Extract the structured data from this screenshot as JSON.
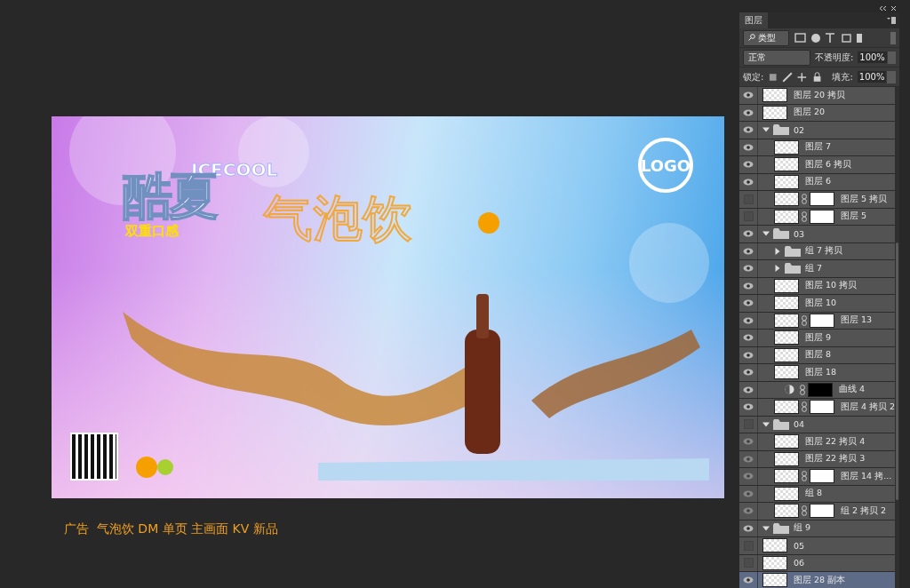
{
  "panel": {
    "tab": "图层",
    "filter": "类型",
    "blend_mode": "正常",
    "opacity_label": "不透明度:",
    "opacity": "100%",
    "lock_label": "锁定:",
    "fill_label": "填充:",
    "fill": "100%"
  },
  "layers": [
    {
      "name": "图层 20 拷贝",
      "kind": "layer",
      "mask": false,
      "visible": true,
      "selected": false
    },
    {
      "name": "图层 20",
      "kind": "layer",
      "mask": false,
      "visible": true,
      "selected": false
    },
    {
      "name": "02",
      "kind": "group",
      "expanded": true,
      "visible": true,
      "selected": false,
      "children": [
        {
          "name": "图层 7",
          "kind": "layer",
          "mask": false,
          "visible": true,
          "selected": false
        },
        {
          "name": "图层 6 拷贝",
          "kind": "layer",
          "mask": false,
          "visible": true,
          "selected": false
        },
        {
          "name": "图层 6",
          "kind": "layer",
          "mask": false,
          "visible": true,
          "selected": false
        },
        {
          "name": "图层 5 拷贝",
          "kind": "layer",
          "mask": true,
          "visible": false,
          "selected": false
        },
        {
          "name": "图层 5",
          "kind": "layer",
          "mask": true,
          "visible": false,
          "selected": false
        }
      ]
    },
    {
      "name": "03",
      "kind": "group",
      "expanded": true,
      "visible": true,
      "selected": false,
      "children": [
        {
          "name": "组 7 拷贝",
          "kind": "group",
          "expanded": false,
          "visible": true,
          "selected": false
        },
        {
          "name": "组 7",
          "kind": "group",
          "expanded": false,
          "visible": true,
          "selected": false
        },
        {
          "name": "图层 10 拷贝",
          "kind": "layer",
          "mask": false,
          "visible": true,
          "selected": false
        },
        {
          "name": "图层 10",
          "kind": "layer",
          "mask": false,
          "visible": true,
          "selected": false
        },
        {
          "name": "图层 13",
          "kind": "layer",
          "mask": true,
          "visible": true,
          "selected": false
        },
        {
          "name": "图层 9",
          "kind": "layer",
          "mask": false,
          "visible": true,
          "selected": false
        },
        {
          "name": "图层 8",
          "kind": "layer",
          "mask": false,
          "visible": true,
          "selected": false
        },
        {
          "name": "图层 18",
          "kind": "layer",
          "mask": false,
          "visible": true,
          "selected": false
        },
        {
          "name": "曲线 4",
          "kind": "adjustment",
          "mask": true,
          "visible": true,
          "selected": false
        },
        {
          "name": "图层 4 拷贝 2",
          "kind": "layer",
          "mask": true,
          "visible": true,
          "selected": false
        }
      ]
    },
    {
      "name": "04",
      "kind": "group",
      "expanded": true,
      "visible": false,
      "selected": false,
      "children": [
        {
          "name": "图层 22 拷贝 4",
          "kind": "layer",
          "mask": false,
          "visible": true,
          "selected": false
        },
        {
          "name": "图层 22 拷贝 3",
          "kind": "layer",
          "mask": false,
          "visible": true,
          "selected": false
        },
        {
          "name": "图层 14 拷...",
          "kind": "layer",
          "mask": true,
          "visible": true,
          "selected": false
        },
        {
          "name": "组 8",
          "kind": "layer",
          "mask": false,
          "visible": true,
          "selected": false
        },
        {
          "name": "组 2 拷贝 2",
          "kind": "layer",
          "mask": true,
          "visible": true,
          "selected": false
        }
      ]
    },
    {
      "name": "组 9",
      "kind": "group",
      "expanded": true,
      "visible": true,
      "selected": false
    },
    {
      "name": "05",
      "kind": "layer",
      "mask": false,
      "visible": false,
      "selected": false
    },
    {
      "name": "06",
      "kind": "layer",
      "mask": false,
      "visible": false,
      "selected": false
    },
    {
      "name": "图层 28 副本",
      "kind": "layer",
      "mask": false,
      "visible": true,
      "selected": true
    }
  ],
  "canvas": {
    "title_en": "ICECOOL",
    "title_cn": "酷夏",
    "tagline": "双重口感",
    "product": "气泡饮",
    "logo": "LOGO"
  },
  "caption": "广告  气泡饮 DM 单页 主画面 KV 新品"
}
